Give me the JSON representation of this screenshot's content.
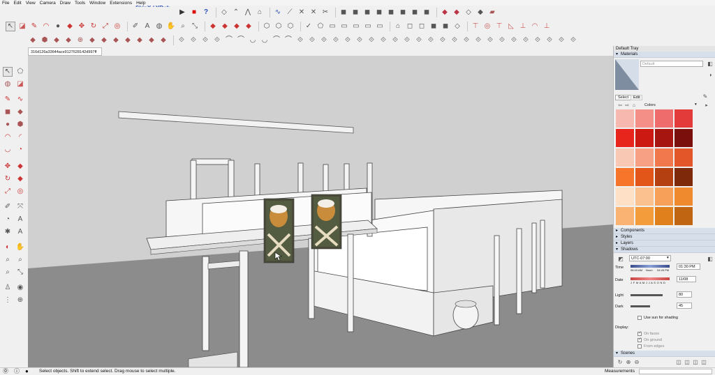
{
  "menu": [
    "File",
    "Edit",
    "View",
    "Camera",
    "Draw",
    "Tools",
    "Window",
    "Extensions",
    "Help"
  ],
  "toolbar": {
    "plugin_label": "SkinX / YBub"
  },
  "file_tab": "316d126a33644ace9127628142d997ff",
  "tray": {
    "title": "Default Tray",
    "materials": {
      "header": "Materials",
      "default_name": "Default",
      "tabs": [
        "Select",
        "Edit"
      ],
      "collection": "Colors",
      "swatches": [
        "#f7b8b0",
        "#f48f88",
        "#ef6c6c",
        "#e33a3a",
        "#e8251d",
        "#cc1a12",
        "#a61510",
        "#7a0f0c",
        "#f9c8b4",
        "#f7a083",
        "#f0784c",
        "#e2562a",
        "#f7752a",
        "#e2561a",
        "#b43f10",
        "#7e2a0a",
        "#fde0c6",
        "#fbc18f",
        "#f6a05a",
        "#f08a2e",
        "#fbb373",
        "#f39c3c",
        "#e0801c",
        "#c06512"
      ]
    },
    "panels": [
      "Components",
      "Styles",
      "Layers"
    ],
    "shadows": {
      "header": "Shadows",
      "timezone": "UTC-07:00",
      "time_label": "Time",
      "time_start": "06:43 AM",
      "time_noon": "Noon",
      "time_end": "04:45 PM",
      "time_value": "01:30 PM",
      "date_label": "Date",
      "months": "J F M A M J J A S O N D",
      "date_value": "11/08",
      "light_label": "Light",
      "light_value": "80",
      "dark_label": "Dark",
      "dark_value": "45",
      "use_sun": "Use sun for shading",
      "display_label": "Display:",
      "display_options": [
        "On faces",
        "On ground",
        "From edges"
      ]
    },
    "scenes_header": "Scenes"
  },
  "status": {
    "text": "Select objects. Shift to extend select. Drag mouse to select multiple.",
    "measurements_label": "Measurements"
  },
  "colors": {
    "accent": "#2a4fb5",
    "panel_header": "#d7dfea",
    "ground": "#8c8c8c",
    "sky": "#d0d0d0"
  }
}
